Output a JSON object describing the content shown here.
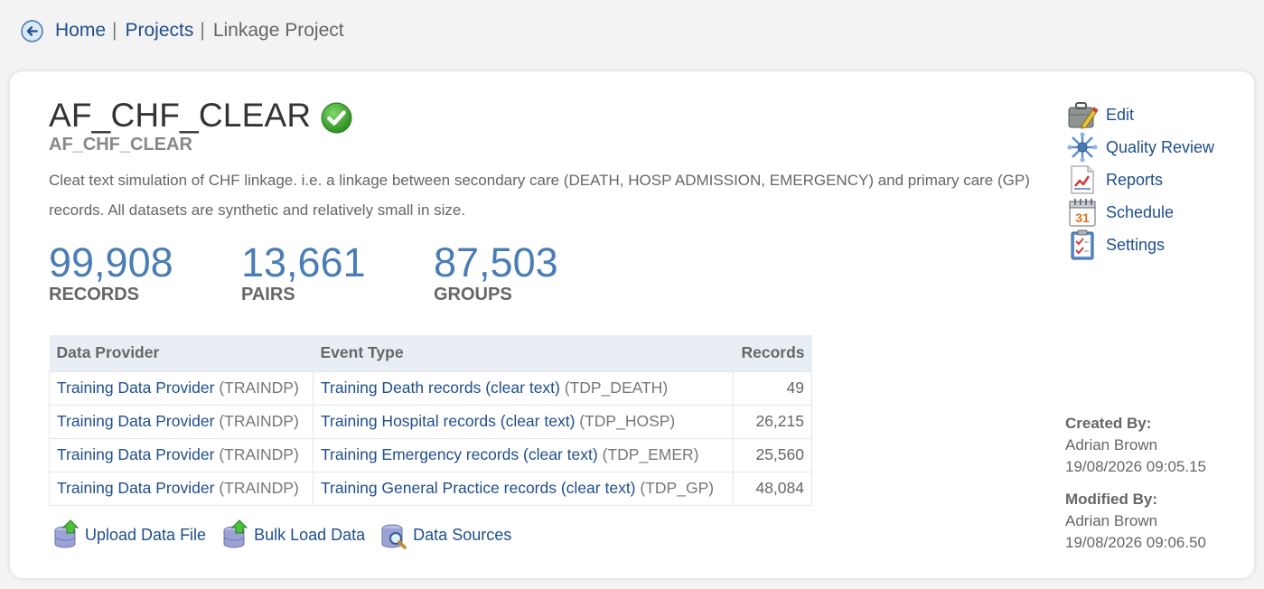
{
  "breadcrumb": {
    "home": "Home",
    "sep1": "|",
    "projects": "Projects",
    "sep2": "|",
    "current": "Linkage Project"
  },
  "project": {
    "title": "AF_CHF_CLEAR",
    "subtitle": "AF_CHF_CLEAR",
    "description": "Cleat text simulation of CHF linkage. i.e. a linkage between secondary care (DEATH, HOSP ADMISSION, EMERGENCY) and primary care (GP) records. All datasets are synthetic and relatively small in size."
  },
  "stats": [
    {
      "value": "99,908",
      "label": "RECORDS"
    },
    {
      "value": "13,661",
      "label": "PAIRS"
    },
    {
      "value": "87,503",
      "label": "GROUPS"
    }
  ],
  "table": {
    "headers": [
      "Data Provider",
      "Event Type",
      "Records"
    ],
    "rows": [
      {
        "provider": "Training Data Provider",
        "provider_code": "(TRAINDP)",
        "event": "Training Death records (clear text)",
        "event_code": "(TDP_DEATH)",
        "records": "49"
      },
      {
        "provider": "Training Data Provider",
        "provider_code": "(TRAINDP)",
        "event": "Training Hospital records (clear text)",
        "event_code": "(TDP_HOSP)",
        "records": "26,215"
      },
      {
        "provider": "Training Data Provider",
        "provider_code": "(TRAINDP)",
        "event": "Training Emergency records (clear text)",
        "event_code": "(TDP_EMER)",
        "records": "25,560"
      },
      {
        "provider": "Training Data Provider",
        "provider_code": "(TRAINDP)",
        "event": "Training General Practice records (clear text)",
        "event_code": "(TDP_GP)",
        "records": "48,084"
      }
    ]
  },
  "actions": {
    "upload": "Upload Data File",
    "bulk": "Bulk Load Data",
    "sources": "Data Sources"
  },
  "side_menu": {
    "edit": "Edit",
    "quality": "Quality Review",
    "reports": "Reports",
    "schedule": "Schedule",
    "schedule_day": "31",
    "settings": "Settings"
  },
  "meta": {
    "created_label": "Created By:",
    "created_by": "Adrian Brown",
    "created_at": "19/08/2026 09:05.15",
    "modified_label": "Modified By:",
    "modified_by": "Adrian Brown",
    "modified_at": "19/08/2026 09:06.50"
  },
  "colors": {
    "link": "#1f4e8c",
    "stat": "#4a7db5",
    "success": "#3aa12f",
    "table_header_bg": "#e9eef5"
  }
}
